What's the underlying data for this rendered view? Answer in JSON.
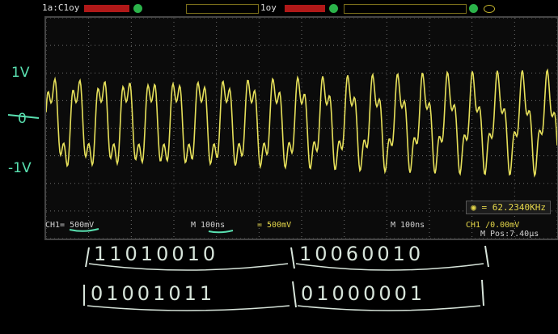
{
  "topbar": {
    "left_label": "1a:C1oy",
    "mid_label": "1oy"
  },
  "scope": {
    "frequency": "= 62.2340KHz",
    "ch1_scale": "CH1= 500mV",
    "time_scale_1": "M 100ns",
    "ch2_scale": "= 500mV",
    "time_scale_2": "M 100ns",
    "trigger": "CH1 /0.00mV",
    "m_pos": "M Pos:7.40µs"
  },
  "annotations": {
    "level_high": "1V",
    "level_zero": "0",
    "level_low": "-1V",
    "row1_a": "11010010",
    "row1_b": "10060010",
    "row2_a": "01001011",
    "row2_b": "01000001"
  },
  "colors": {
    "trace": "#e6e05a",
    "grid": "#6d6d6d",
    "handwriting": "#59e0b0"
  },
  "icons": [
    "status-led-icon",
    "trigger-icon",
    "frequency-icon"
  ]
}
